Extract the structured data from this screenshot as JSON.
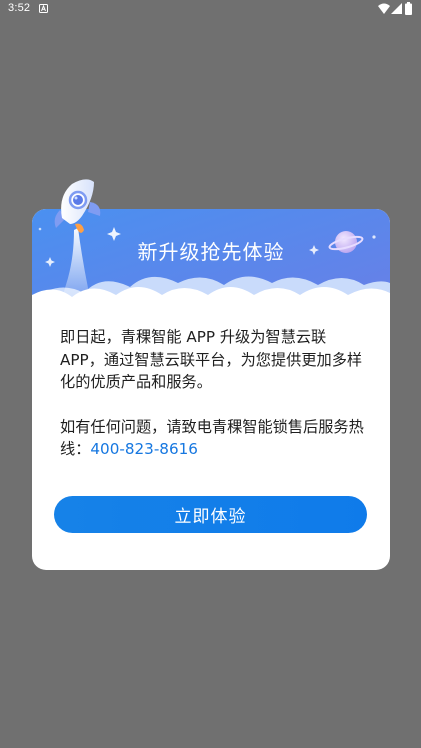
{
  "status_bar": {
    "time": "3:52",
    "icons": [
      "notification-a-icon",
      "wifi-icon",
      "signal-icon",
      "battery-icon"
    ]
  },
  "dialog": {
    "title": "新升级抢先体验",
    "paragraph1": "即日起，青稞智能 APP 升级为智慧云联 APP，通过智慧云联平台，为您提供更加多样化的优质产品和服务。",
    "paragraph2_prefix": "如有任何问题，请致电青稞智能锁售后服务热线：",
    "hotline": "400-823-8616",
    "button_label": "立即体验",
    "decorations": [
      "rocket-icon",
      "planet-icon",
      "sparkle-icon",
      "cloud-shape"
    ]
  },
  "colors": {
    "overlay": "#707070",
    "header_gradient_start": "#4e8ef0",
    "header_gradient_end": "#6d7fe8",
    "accent": "#1677e0",
    "text": "#1f1f1f"
  }
}
